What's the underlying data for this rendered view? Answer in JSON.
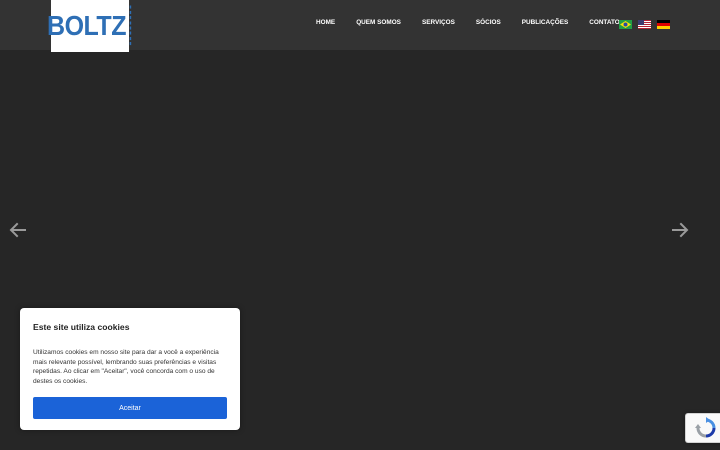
{
  "brand": {
    "logo_text": "BOLTZ",
    "logo_color": "#2e6fb5"
  },
  "nav": {
    "items": [
      {
        "label": "HOME"
      },
      {
        "label": "QUEM SOMOS"
      },
      {
        "label": "SERVIÇOS"
      },
      {
        "label": "SÓCIOS"
      },
      {
        "label": "PUBLICAÇÕES"
      },
      {
        "label": "CONTATO"
      }
    ]
  },
  "languages": [
    {
      "icon": "flag-brazil-icon"
    },
    {
      "icon": "flag-usa-icon"
    },
    {
      "icon": "flag-germany-icon"
    }
  ],
  "slider": {
    "prev_icon": "arrow-left-icon",
    "next_icon": "arrow-right-icon"
  },
  "cookie_banner": {
    "title": "Este site utiliza cookies",
    "text": "Utilizamos cookies em nosso site para dar a você a experiência mais relevante possível, lembrando suas preferências e visitas repetidas. Ao clicar em \"Aceitar\", você concorda com o uso de destes os cookies.",
    "accept_label": "Aceitar",
    "accept_color": "#1b63d8"
  },
  "recaptcha": {
    "icon": "recaptcha-icon"
  },
  "colors": {
    "header_bg": "#333333",
    "page_bg": "#262626"
  }
}
